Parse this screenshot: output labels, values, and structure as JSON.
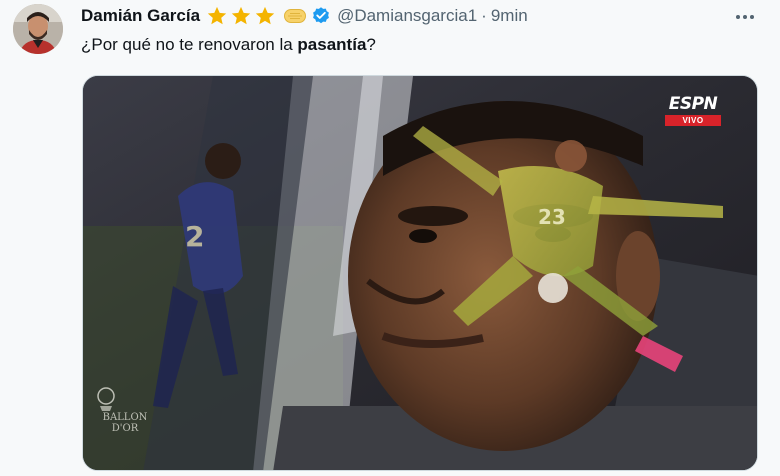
{
  "author": {
    "display_name": "Damián García",
    "handle": "@Damiansgarcia1",
    "separator": "·",
    "time": "9min"
  },
  "icons": {
    "stars": [
      "star-icon",
      "star-icon",
      "star-icon"
    ],
    "emoji": "emoji-chip-icon",
    "verified": "verified-badge-icon",
    "more": "more-options-icon"
  },
  "colors": {
    "star": "#f4b400",
    "verified": "#1d9bf0",
    "espn_red": "#d8232a"
  },
  "tweet": {
    "text_before": "¿Por qué no te renovaron la ",
    "text_bold": "pasantía",
    "text_after": "?"
  },
  "media": {
    "broadcaster": "ESPN",
    "live_badge": "VIVO",
    "jersey_left": "2",
    "jersey_right": "23",
    "award_logo_line1": "BALLON",
    "award_logo_line2": "D'OR"
  }
}
